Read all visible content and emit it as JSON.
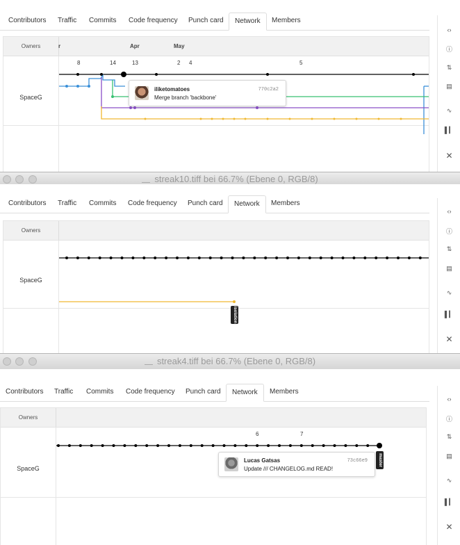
{
  "tabs": [
    "Contributors",
    "Traffic",
    "Commits",
    "Code frequency",
    "Punch card",
    "Network",
    "Members"
  ],
  "owners_label": "Owners",
  "owner": "SpaceG",
  "windows": [
    {
      "title": "streak10.tiff bei 66.7% (Ebene 0, RGB/8)"
    },
    {
      "title": "streak4.tiff bei 66.7% (Ebene 0, RGB/8)"
    }
  ],
  "panel1": {
    "months": [
      "r",
      "Apr",
      "May"
    ],
    "days": [
      "8",
      "14",
      "13",
      "2",
      "4",
      "5"
    ],
    "tooltip": {
      "user": "iliketomatoes",
      "message": "Merge branch 'backbone'",
      "sha": "770c2a2"
    }
  },
  "panel2": {
    "tag": "isolation"
  },
  "panel3": {
    "days": [
      "6",
      "7"
    ],
    "tooltip": {
      "user": "Lucas Gatsas",
      "message": "Update /// CHANGELOG.md READ!",
      "sha": "73c66e9"
    },
    "tag": "master"
  },
  "rail_icons": [
    "code-icon",
    "issue-icon",
    "pull-request-icon",
    "wiki-icon",
    "pulse-icon",
    "graphs-icon",
    "settings-icon"
  ],
  "colors": {
    "master": "#000000",
    "blue": "#3a8fd8",
    "green": "#38c172",
    "purple": "#8a4fc8",
    "yellow": "#f0b830",
    "accent": "#d26911"
  }
}
